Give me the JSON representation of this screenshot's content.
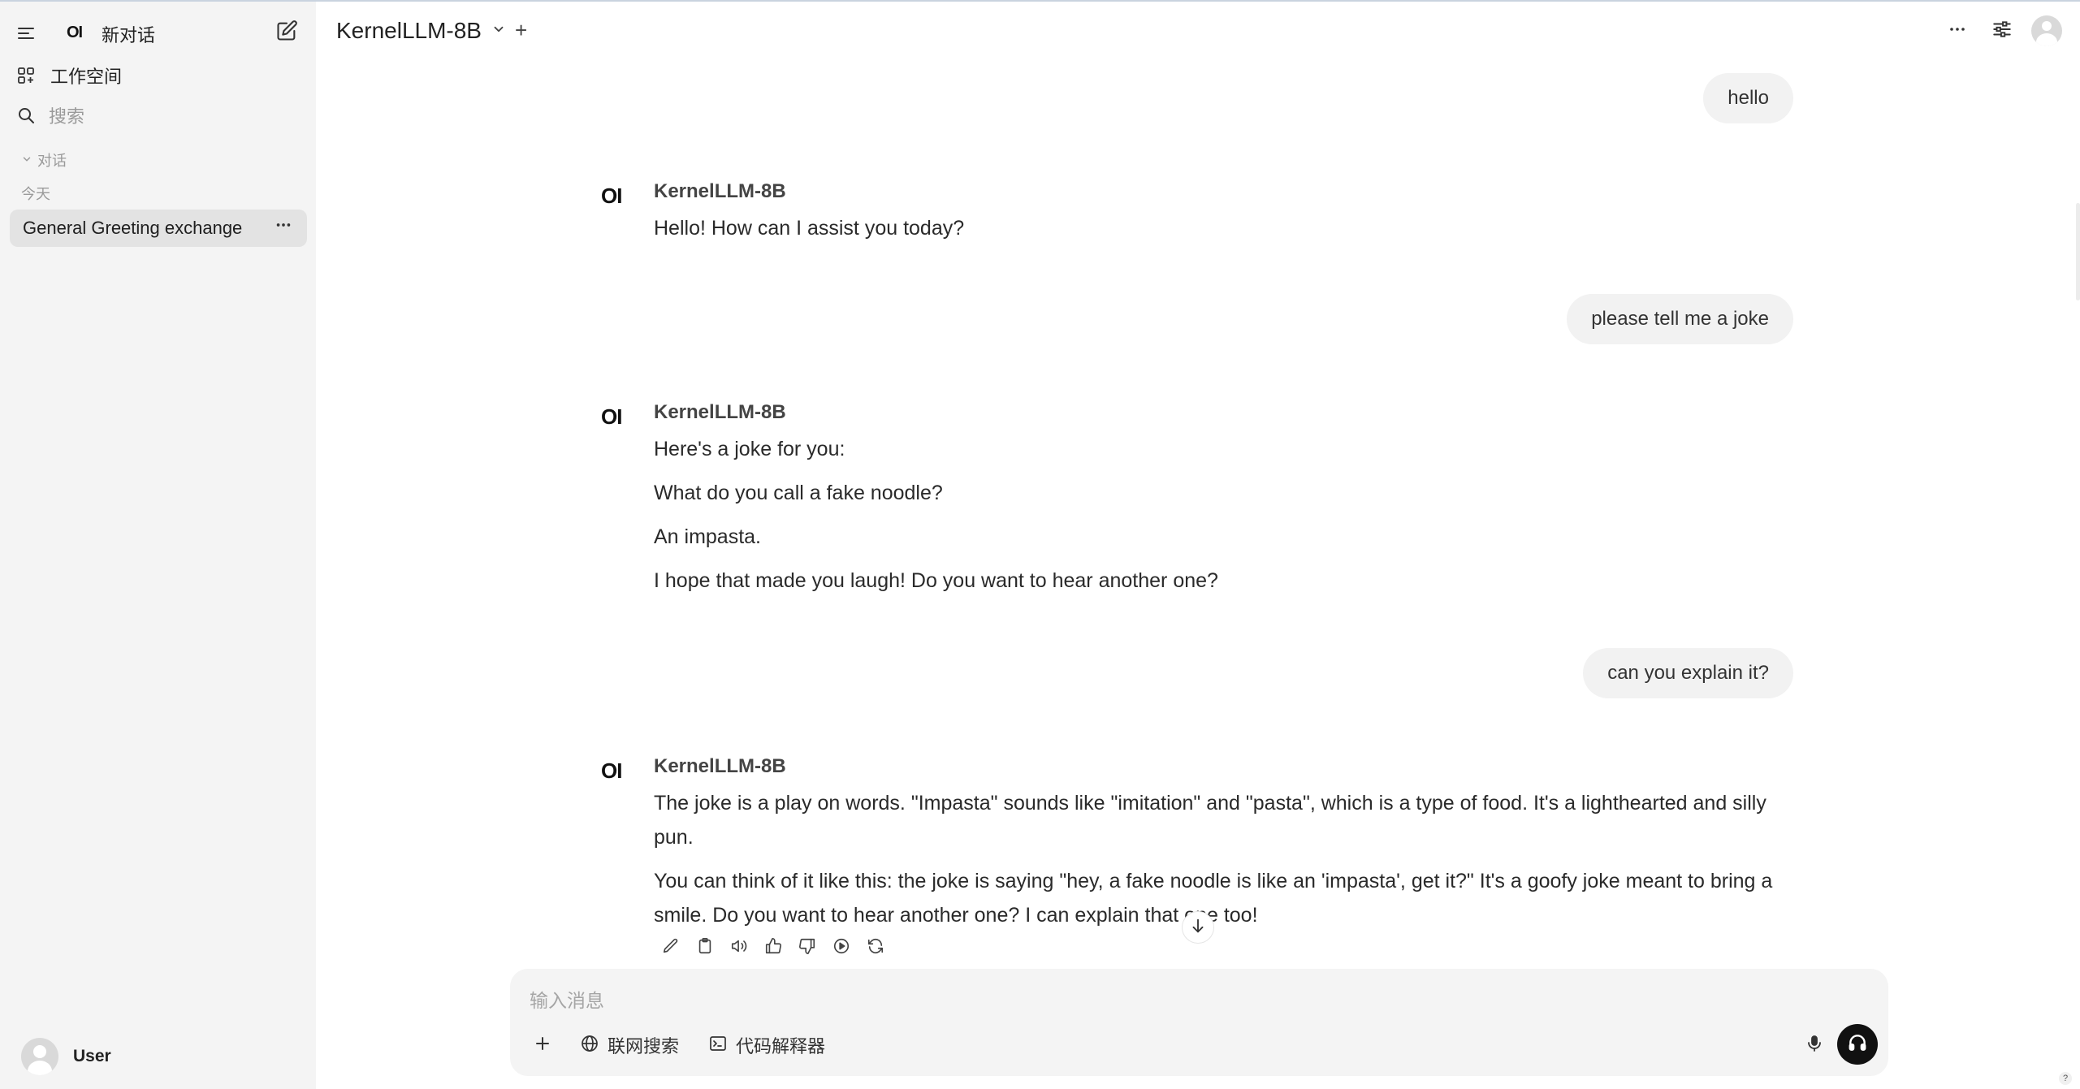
{
  "sidebar": {
    "new_chat_label": "新对话",
    "logo_text": "OI",
    "workspace_label": "工作空间",
    "search_placeholder": "搜索",
    "section_label": "对话",
    "group_label": "今天",
    "chats": [
      {
        "title": "General Greeting exchange",
        "selected": true
      }
    ],
    "user_name": "User"
  },
  "header": {
    "model_name": "KernelLLM-8B",
    "add_model_symbol": "+",
    "more_symbol": "···"
  },
  "messages": [
    {
      "role": "user",
      "text": "hello"
    },
    {
      "role": "assistant",
      "model": "KernelLLM-8B",
      "logo": "OI",
      "paragraphs": [
        "Hello! How can I assist you today?"
      ]
    },
    {
      "role": "user",
      "text": "please tell me a joke"
    },
    {
      "role": "assistant",
      "model": "KernelLLM-8B",
      "logo": "OI",
      "paragraphs": [
        "Here's a joke for you:",
        "What do you call a fake noodle?",
        "An impasta.",
        "I hope that made you laugh! Do you want to hear another one?"
      ]
    },
    {
      "role": "user",
      "text": "can you explain it?"
    },
    {
      "role": "assistant",
      "model": "KernelLLM-8B",
      "logo": "OI",
      "paragraphs": [
        "The joke is a play on words. \"Impasta\" sounds like \"imitation\" and \"pasta\", which is a type of food. It's a lighthearted and silly pun.",
        "You can think of it like this: the joke is saying \"hey, a fake noodle is like an 'impasta', get it?\" It's a goofy joke meant to bring a smile. Do you want to hear another one? I can explain that one too!"
      ]
    }
  ],
  "message_actions": [
    "edit-icon",
    "copy-icon",
    "speaker-icon",
    "thumbs-up-icon",
    "thumbs-down-icon",
    "play-icon",
    "regenerate-icon"
  ],
  "composer": {
    "placeholder": "输入消息",
    "web_search_label": "联网搜索",
    "code_interpreter_label": "代码解释器"
  },
  "help_symbol": "?"
}
